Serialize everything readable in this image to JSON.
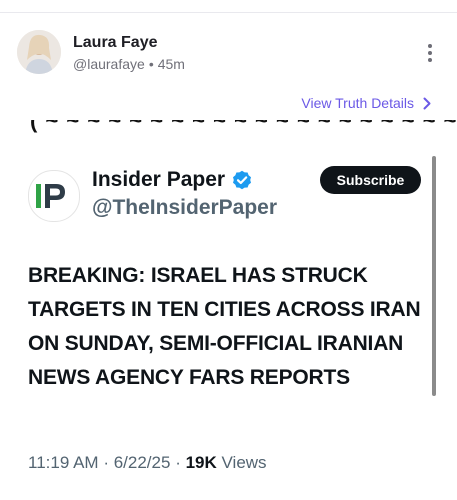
{
  "post": {
    "author": {
      "name": "Laura Faye",
      "handle": "@laurafaye",
      "separator": "•",
      "age": "45m",
      "avatar_icon": "profile-photo"
    },
    "more_icon": "vertical-ellipsis-icon",
    "view_details_label": "View Truth Details",
    "link_color": "#6b59e6"
  },
  "embed": {
    "cut_text": "( ~ ~ ~ ~ ~ ~ ~ ~ ~ ~ ~ ~ ~ ~ ~ ~ ~ ~ ~ ~ ~ ~ ~ ~ ~ ~ ~ )",
    "logo_text": "IP",
    "channel_name": "Insider Paper",
    "channel_handle": "@TheInsiderPaper",
    "verified_icon": "verified-badge-icon",
    "subscribe_label": "Subscribe",
    "headline": "BREAKING: ISRAEL HAS STRUCK TARGETS IN TEN CITIES ACROSS IRAN ON SUNDAY, SEMI-OFFICIAL IRANIAN NEWS AGENCY FARS REPORTS",
    "time": "11:19 AM",
    "date": "6/22/25",
    "dot": "·",
    "views_count": "19K",
    "views_label": "Views"
  }
}
